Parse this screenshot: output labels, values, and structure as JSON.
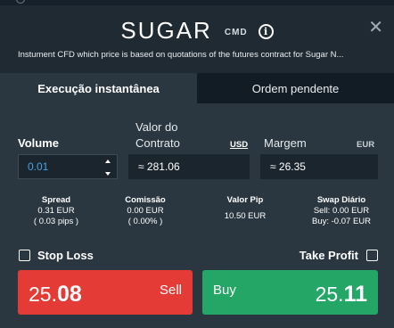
{
  "header": {
    "title": "SUGAR",
    "badge": "CMD",
    "info_glyph": "i",
    "close_glyph": "✕",
    "subtitle": "Instument CFD which price is based on quotations of the futures contract for Sugar N..."
  },
  "tabs": [
    {
      "label": "Execução instantânea",
      "active": true
    },
    {
      "label": "Ordem pendente",
      "active": false
    }
  ],
  "form": {
    "volume_label": "Volume",
    "volume_value": "0.01",
    "contract_label_line1": "Valor do",
    "contract_label_line2": "Contrato",
    "contract_currency": "USD",
    "contract_value": "≈ 281.06",
    "margin_label": "Margem",
    "margin_currency": "EUR",
    "margin_value": "≈ 26.35"
  },
  "stats": {
    "spread": {
      "label": "Spread",
      "line1": "0.31 EUR",
      "line2": "( 0.03 pips )"
    },
    "commission": {
      "label": "Comissão",
      "line1": "0.00 EUR",
      "line2": "( 0.00% )"
    },
    "pip_value": {
      "label": "Valor Pip",
      "line1": "10.50 EUR"
    },
    "swap": {
      "label": "Swap Diário",
      "line1": "Sell: 0.00 EUR",
      "line2": "Buy: -0.07 EUR"
    }
  },
  "options": {
    "stop_loss_label": "Stop Loss",
    "take_profit_label": "Take Profit"
  },
  "trade": {
    "sell_label": "Sell",
    "sell_price_main": "25.",
    "sell_price_big": "08",
    "buy_label": "Buy",
    "buy_price_main": "25.",
    "buy_price_big": "11",
    "sell_color": "#e43b36",
    "buy_color": "#23a666"
  },
  "icons": {
    "info": "info-icon",
    "close": "close-icon",
    "stepper": "stepper-icon",
    "checkbox": "checkbox-icon"
  }
}
